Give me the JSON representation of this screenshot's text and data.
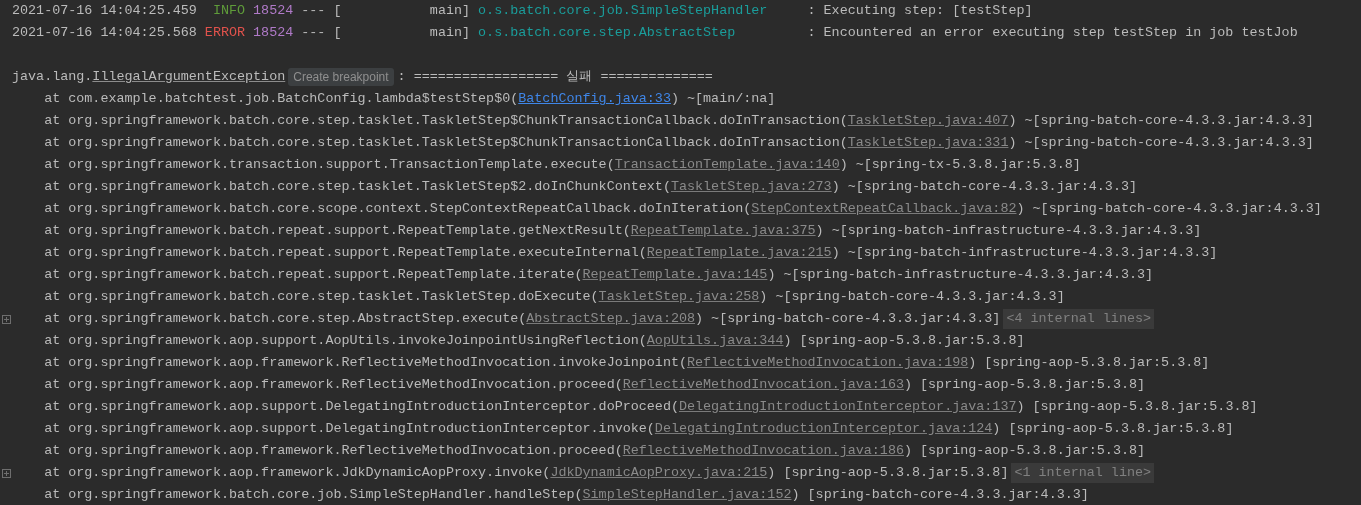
{
  "log_entries": [
    {
      "timestamp": "2021-07-16 14:04:25.459",
      "level": "INFO",
      "pid": "18524",
      "separator": "---",
      "thread": "[           main]",
      "logger": "o.s.batch.core.job.SimpleStepHandler",
      "message": ": Executing step: [testStep]"
    },
    {
      "timestamp": "2021-07-16 14:04:25.568",
      "level": "ERROR",
      "pid": "18524",
      "separator": "---",
      "thread": "[           main]",
      "logger": "o.s.batch.core.step.AbstractStep",
      "message": ": Encountered an error executing step testStep in job testJob"
    }
  ],
  "exception": {
    "package": "java.lang.",
    "class_link": "IllegalArgumentException",
    "hint_button": "Create breakpoint",
    "message": ": ================== 실패 =============="
  },
  "stack_frames": [
    {
      "kind": "user",
      "call": "at com.example.batchtest.job.BatchConfig.lambda$testStep$0(",
      "source": "BatchConfig.java:33",
      "suffix": ") ~[main/:na]"
    },
    {
      "kind": "library",
      "call": "at org.springframework.batch.core.step.tasklet.TaskletStep$ChunkTransactionCallback.doInTransaction(",
      "source": "TaskletStep.java:407",
      "suffix": ") ~[spring-batch-core-4.3.3.jar:4.3.3]"
    },
    {
      "kind": "library",
      "call": "at org.springframework.batch.core.step.tasklet.TaskletStep$ChunkTransactionCallback.doInTransaction(",
      "source": "TaskletStep.java:331",
      "suffix": ") ~[spring-batch-core-4.3.3.jar:4.3.3]"
    },
    {
      "kind": "library",
      "call": "at org.springframework.transaction.support.TransactionTemplate.execute(",
      "source": "TransactionTemplate.java:140",
      "suffix": ") ~[spring-tx-5.3.8.jar:5.3.8]"
    },
    {
      "kind": "library",
      "call": "at org.springframework.batch.core.step.tasklet.TaskletStep$2.doInChunkContext(",
      "source": "TaskletStep.java:273",
      "suffix": ") ~[spring-batch-core-4.3.3.jar:4.3.3]"
    },
    {
      "kind": "library",
      "call": "at org.springframework.batch.core.scope.context.StepContextRepeatCallback.doInIteration(",
      "source": "StepContextRepeatCallback.java:82",
      "suffix": ") ~[spring-batch-core-4.3.3.jar:4.3.3]"
    },
    {
      "kind": "library",
      "call": "at org.springframework.batch.repeat.support.RepeatTemplate.getNextResult(",
      "source": "RepeatTemplate.java:375",
      "suffix": ") ~[spring-batch-infrastructure-4.3.3.jar:4.3.3]"
    },
    {
      "kind": "library",
      "call": "at org.springframework.batch.repeat.support.RepeatTemplate.executeInternal(",
      "source": "RepeatTemplate.java:215",
      "suffix": ") ~[spring-batch-infrastructure-4.3.3.jar:4.3.3]"
    },
    {
      "kind": "library",
      "call": "at org.springframework.batch.repeat.support.RepeatTemplate.iterate(",
      "source": "RepeatTemplate.java:145",
      "suffix": ") ~[spring-batch-infrastructure-4.3.3.jar:4.3.3]"
    },
    {
      "kind": "library",
      "call": "at org.springframework.batch.core.step.tasklet.TaskletStep.doExecute(",
      "source": "TaskletStep.java:258",
      "suffix": ") ~[spring-batch-core-4.3.3.jar:4.3.3]"
    },
    {
      "kind": "library",
      "call": "at org.springframework.batch.core.step.AbstractStep.execute(",
      "source": "AbstractStep.java:208",
      "suffix": ") ~[spring-batch-core-4.3.3.jar:4.3.3]",
      "folded_lines": "<4 internal lines>"
    },
    {
      "kind": "library",
      "call": "at org.springframework.aop.support.AopUtils.invokeJoinpointUsingReflection(",
      "source": "AopUtils.java:344",
      "suffix": ") [spring-aop-5.3.8.jar:5.3.8]"
    },
    {
      "kind": "library",
      "call": "at org.springframework.aop.framework.ReflectiveMethodInvocation.invokeJoinpoint(",
      "source": "ReflectiveMethodInvocation.java:198",
      "suffix": ") [spring-aop-5.3.8.jar:5.3.8]"
    },
    {
      "kind": "library",
      "call": "at org.springframework.aop.framework.ReflectiveMethodInvocation.proceed(",
      "source": "ReflectiveMethodInvocation.java:163",
      "suffix": ") [spring-aop-5.3.8.jar:5.3.8]"
    },
    {
      "kind": "library",
      "call": "at org.springframework.aop.support.DelegatingIntroductionInterceptor.doProceed(",
      "source": "DelegatingIntroductionInterceptor.java:137",
      "suffix": ") [spring-aop-5.3.8.jar:5.3.8]"
    },
    {
      "kind": "library",
      "call": "at org.springframework.aop.support.DelegatingIntroductionInterceptor.invoke(",
      "source": "DelegatingIntroductionInterceptor.java:124",
      "suffix": ") [spring-aop-5.3.8.jar:5.3.8]"
    },
    {
      "kind": "library",
      "call": "at org.springframework.aop.framework.ReflectiveMethodInvocation.proceed(",
      "source": "ReflectiveMethodInvocation.java:186",
      "suffix": ") [spring-aop-5.3.8.jar:5.3.8]"
    },
    {
      "kind": "library",
      "call": "at org.springframework.aop.framework.JdkDynamicAopProxy.invoke(",
      "source": "JdkDynamicAopProxy.java:215",
      "suffix": ") [spring-aop-5.3.8.jar:5.3.8]",
      "folded_lines": "<1 internal line>"
    },
    {
      "kind": "library",
      "call": "at org.springframework.batch.core.job.SimpleStepHandler.handleStep(",
      "source": "SimpleStepHandler.java:152",
      "suffix": ") [spring-batch-core-4.3.3.jar:4.3.3]"
    }
  ]
}
